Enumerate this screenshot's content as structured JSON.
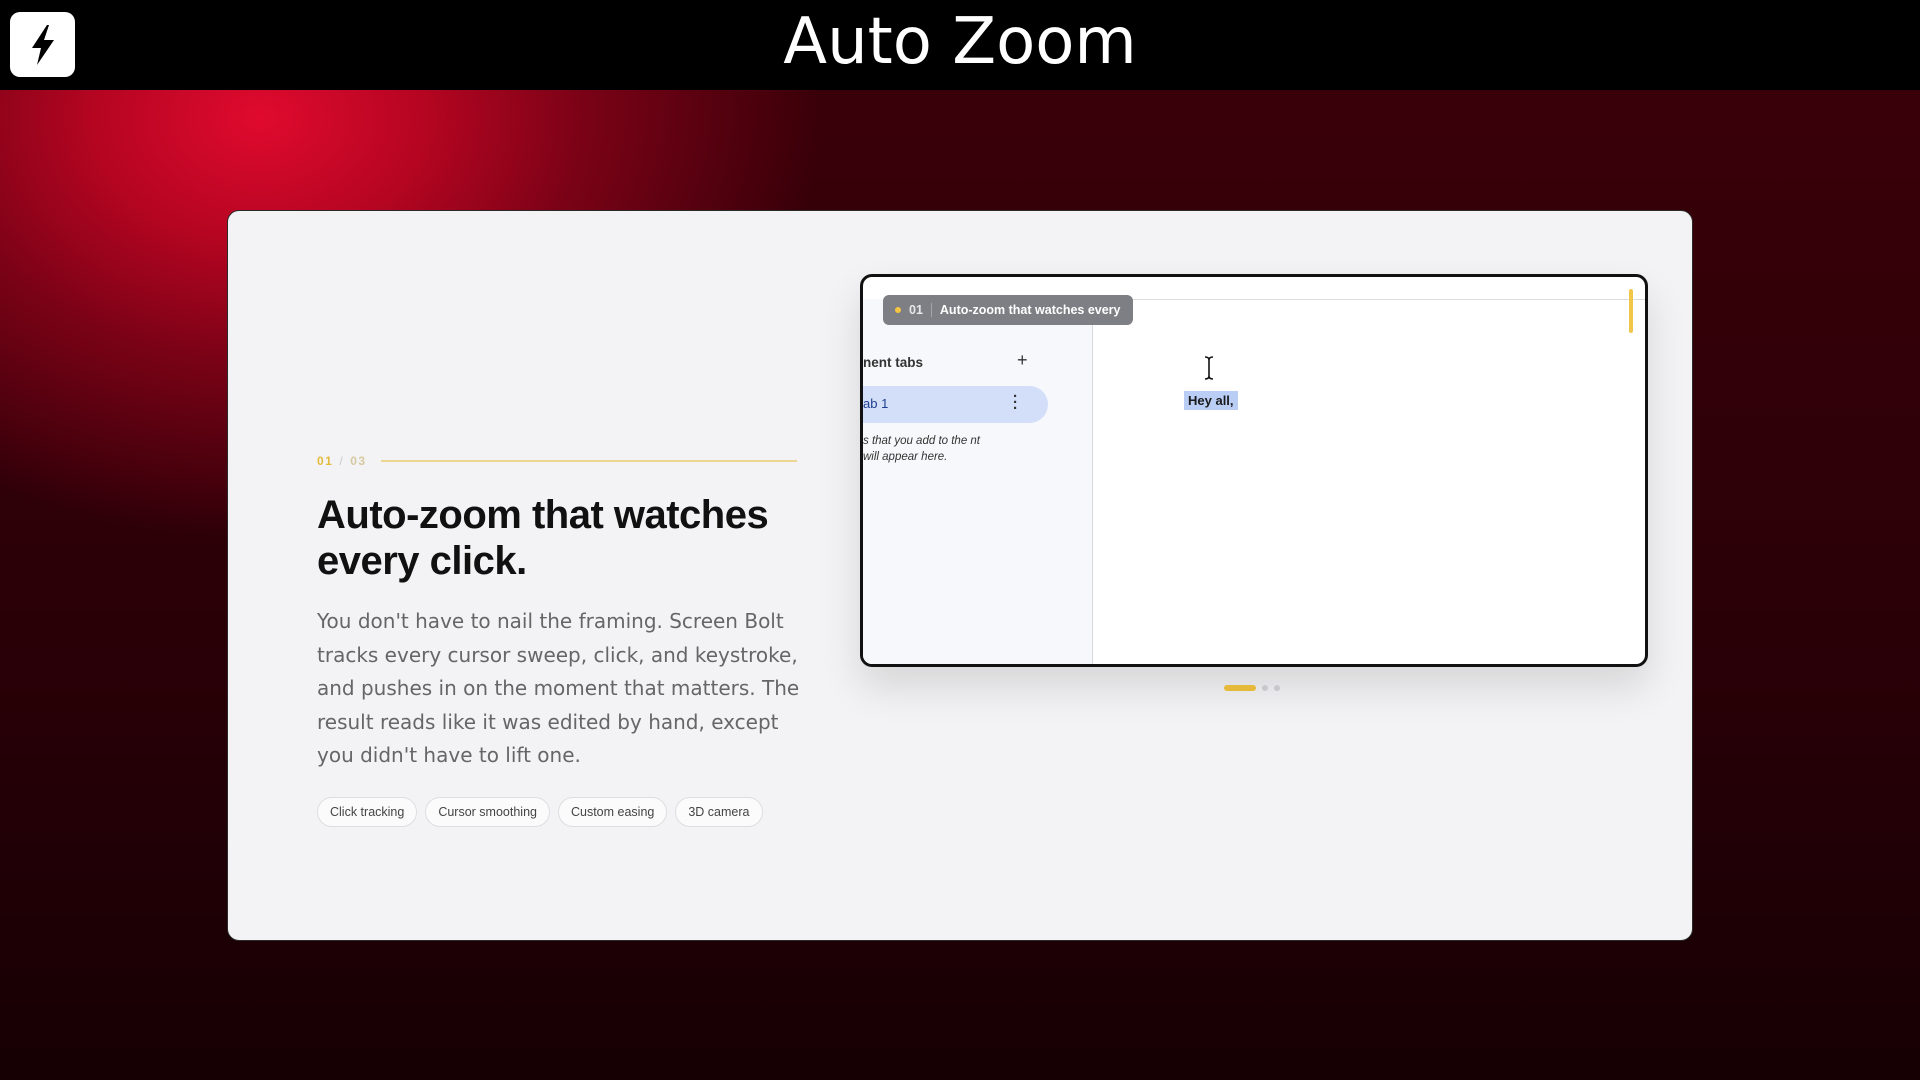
{
  "header": {
    "app_title": "Auto Zoom",
    "logo_icon": "lightning-bolt-icon"
  },
  "feature": {
    "counter_current": "01",
    "counter_separator": "/",
    "counter_total": "03",
    "headline": "Auto-zoom that watches every click.",
    "description": "You don't have to nail the framing. Screen Bolt tracks every cursor sweep, click, and keystroke, and pushes in on the moment that matters. The result reads like it was edited by hand, except you didn't have to lift one.",
    "tags": [
      "Click tracking",
      "Cursor smoothing",
      "Custom easing",
      "3D camera"
    ]
  },
  "preview": {
    "pill_number": "01",
    "pill_label": "Auto-zoom that watches every",
    "sidebar_title": "nent tabs",
    "add_icon": "plus-icon",
    "tab_label": "ab 1",
    "tab_menu_icon": "vertical-dots-icon",
    "sidebar_note": "s that you add to the nt will appear here.",
    "doc_text": "Hey all,",
    "cursor_icon": "text-cursor-icon"
  },
  "carousel": {
    "active_index": 0,
    "total": 3
  },
  "colors": {
    "accent": "#e5b93a",
    "background_red": "#e00a2e",
    "selection": "#b9cdf5"
  }
}
